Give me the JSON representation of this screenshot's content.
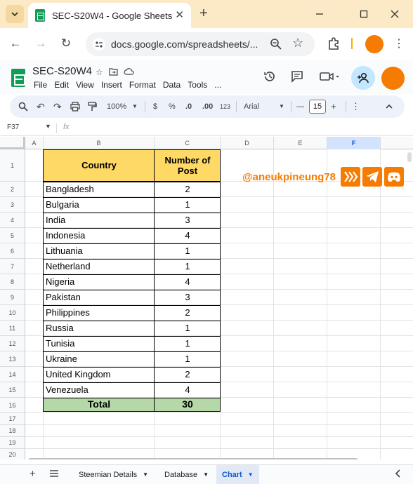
{
  "browser": {
    "tab_title": "SEC-S20W4 - Google Sheets",
    "tab_close": "✕",
    "new_tab": "+",
    "url": "docs.google.com/spreadsheets/...",
    "accent_color": "#fce9c6",
    "profile_color": "#f57c00"
  },
  "sheets": {
    "doc_title": "SEC-S20W4",
    "menu": [
      "File",
      "Edit",
      "View",
      "Insert",
      "Format",
      "Data",
      "Tools",
      "..."
    ],
    "toolbar": {
      "zoom": "100%",
      "currency": "$",
      "percent": "%",
      "dec_decrease": ".0",
      "dec_increase": ".00",
      "number_format": "123",
      "font": "Arial",
      "font_size": "15",
      "minus": "—",
      "plus": "+"
    },
    "name_box": "F37",
    "fx": "fx"
  },
  "grid": {
    "columns": [
      "A",
      "B",
      "C",
      "D",
      "E",
      "F"
    ],
    "selected_column": "F",
    "rows": [
      "1",
      "2",
      "3",
      "4",
      "5",
      "6",
      "7",
      "8",
      "9",
      "10",
      "11",
      "12",
      "13",
      "14",
      "15",
      "16",
      "17",
      "18",
      "19",
      "20"
    ],
    "header_country": "Country",
    "header_posts": "Number of Post",
    "header_fill": "#ffd966",
    "total_fill": "#b6d7a8",
    "data": [
      {
        "country": "Bangladesh",
        "posts": "2"
      },
      {
        "country": "Bulgaria",
        "posts": "1"
      },
      {
        "country": "India",
        "posts": "3"
      },
      {
        "country": "Indonesia",
        "posts": "4"
      },
      {
        "country": "Lithuania",
        "posts": "1"
      },
      {
        "country": "Netherland",
        "posts": "1"
      },
      {
        "country": "Nigeria",
        "posts": "4"
      },
      {
        "country": "Pakistan",
        "posts": "3"
      },
      {
        "country": "Philippines",
        "posts": "2"
      },
      {
        "country": "Russia",
        "posts": "1"
      },
      {
        "country": "Tunisia",
        "posts": "1"
      },
      {
        "country": "Ukraine",
        "posts": "1"
      },
      {
        "country": "United Kingdom",
        "posts": "2"
      },
      {
        "country": "Venezuela",
        "posts": "4"
      }
    ],
    "total_label": "Total",
    "total_value": "30",
    "watermark": "@aneukpineung78",
    "watermark_color": "#f57c00"
  },
  "sheet_tabs": {
    "tabs": [
      "Steemian Details",
      "Database",
      "Chart"
    ],
    "active": "Chart",
    "add": "+"
  }
}
